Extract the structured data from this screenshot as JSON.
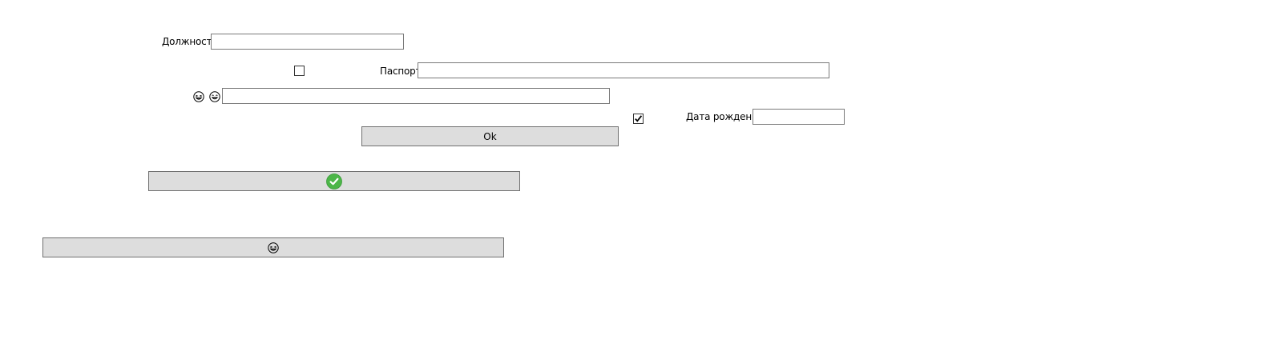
{
  "form": {
    "position_label": "Должность",
    "position_value": "",
    "passport_label": "Паспорт",
    "passport_value": "",
    "emoji_field_value": "",
    "birthdate_label": "Дата рождения",
    "birthdate_value": "",
    "checkbox_1_checked": false,
    "checkbox_2_checked": true
  },
  "buttons": {
    "ok_label": "Ok",
    "check_button_icon": "green-check-icon",
    "emoji_button_icon": "laughing-face-icon"
  },
  "icons": {
    "emoji_label_icons": [
      "laughing-face-icon",
      "grinning-face-icon"
    ]
  },
  "colors": {
    "button_bg": "#dddddd",
    "check_green": "#4cb648"
  }
}
